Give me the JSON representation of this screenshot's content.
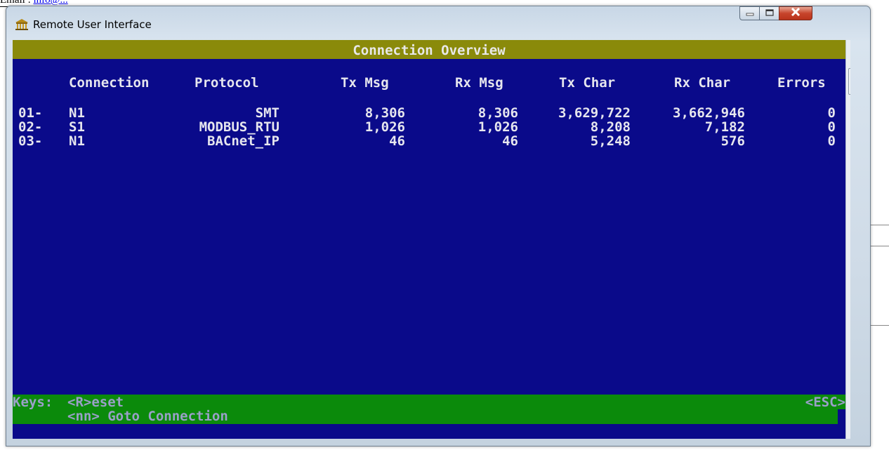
{
  "background_text": {
    "prefix": "Email :",
    "link": "info@..."
  },
  "window": {
    "title": "Remote User Interface"
  },
  "console": {
    "header_title": "Connection Overview",
    "columns": [
      "Connection",
      "Protocol",
      "Tx Msg",
      "Rx Msg",
      "Tx Char",
      "Rx Char",
      "Errors"
    ],
    "rows": [
      {
        "index": "01-",
        "connection": "N1",
        "protocol": "SMT",
        "tx_msg": "8,306",
        "rx_msg": "8,306",
        "tx_char": "3,629,722",
        "rx_char": "3,662,946",
        "errors": "0"
      },
      {
        "index": "02-",
        "connection": "S1",
        "protocol": "MODBUS_RTU",
        "tx_msg": "1,026",
        "rx_msg": "1,026",
        "tx_char": "8,208",
        "rx_char": "7,182",
        "errors": "0"
      },
      {
        "index": "03-",
        "connection": "N1",
        "protocol": "BACnet_IP",
        "tx_msg": "46",
        "rx_msg": "46",
        "tx_char": "5,248",
        "rx_char": "576",
        "errors": "0"
      }
    ],
    "footer": {
      "keys_label": "Keys:",
      "key_reset": "<R>eset",
      "key_goto": "<nn> Goto Connection",
      "key_esc": "<ESC>"
    }
  },
  "colors": {
    "console_bg": "#0a0a8a",
    "header_bg": "#8a8a0a",
    "footer_bg": "#0b8a0b",
    "text": "#e6e6ee"
  },
  "icons": {
    "app": "building-columns-icon",
    "minimize": "minimize-icon",
    "maximize": "maximize-icon",
    "close": "close-icon"
  }
}
